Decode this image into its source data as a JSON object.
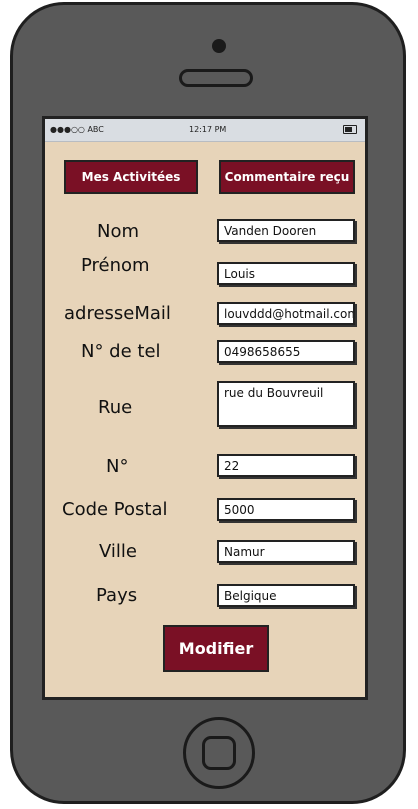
{
  "status_bar": {
    "carrier": "●●●○○ ABC",
    "time": "12:17 PM"
  },
  "buttons": {
    "activities": "Mes Activitées",
    "comments": "Commentaire reçu",
    "modify": "Modifier"
  },
  "form": {
    "nom": {
      "label": "Nom",
      "value": "Vanden Dooren"
    },
    "prenom": {
      "label": "Prénom",
      "value": "Louis"
    },
    "email": {
      "label": "adresseMail",
      "value": "louvddd@hotmail.com"
    },
    "tel": {
      "label": "N° de tel",
      "value": "0498658655"
    },
    "rue": {
      "label": "Rue",
      "value": "rue du Bouvreuil"
    },
    "numero": {
      "label": "N°",
      "value": "22"
    },
    "code_postal": {
      "label": "Code Postal",
      "value": "5000"
    },
    "ville": {
      "label": "Ville",
      "value": "Namur"
    },
    "pays": {
      "label": "Pays",
      "value": "Belgique"
    }
  }
}
